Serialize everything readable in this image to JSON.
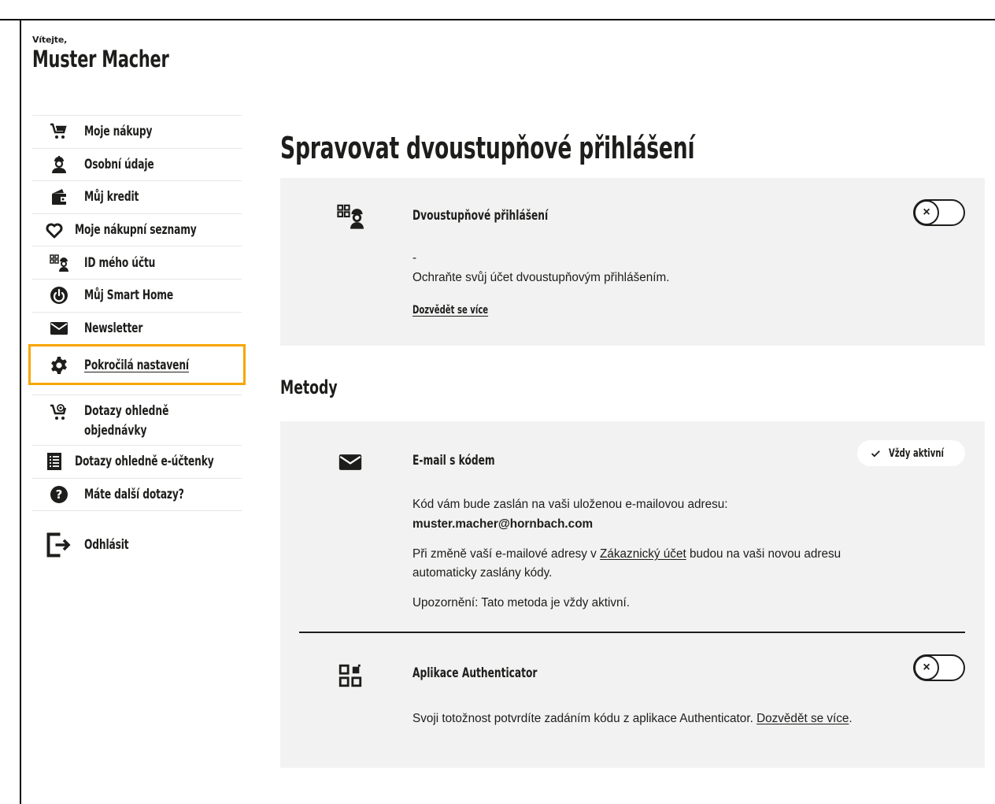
{
  "greeting": {
    "welcome": "Vítejte,",
    "name": "Muster Macher"
  },
  "sidebar": {
    "items": [
      {
        "label": "Moje nákupy",
        "icon": "cart-icon"
      },
      {
        "label": "Osobní údaje",
        "icon": "worker-icon"
      },
      {
        "label": "Můj kredit",
        "icon": "wallet-icon"
      },
      {
        "label": "Moje nákupní seznamy",
        "icon": "heart-icon"
      },
      {
        "label": "ID mého účtu",
        "icon": "account-id-icon"
      },
      {
        "label": "Můj Smart Home",
        "icon": "power-icon"
      },
      {
        "label": "Newsletter",
        "icon": "mail-icon"
      },
      {
        "label": "Pokročilá nastavení",
        "icon": "gear-icon",
        "active": true
      },
      {
        "label": "Dotazy ohledně",
        "label2": "objednávky",
        "icon": "cart-at-icon"
      },
      {
        "label": "Dotazy ohledně e-účtenky",
        "icon": "receipt-icon"
      },
      {
        "label": "Máte další dotazy?",
        "icon": "question-icon"
      }
    ],
    "logout": {
      "label": "Odhlásit",
      "icon": "logout-icon"
    }
  },
  "main": {
    "title": "Spravovat dvoustupňové přihlášení",
    "two_factor": {
      "title": "Dvoustupňové přihlášení",
      "dash": "-",
      "description": "Ochraňte svůj účet dvoustupňovým přihlášením.",
      "learn_more": "Dozvědět se více",
      "toggle_symbol": "×"
    },
    "methods_title": "Metody",
    "email_method": {
      "title": "E-mail s kódem",
      "badge": "Vždy aktivní",
      "line1": "Kód vám bude zaslán na vaši uloženou e-mailovou adresu:",
      "email": "muster.macher@hornbach.com",
      "line2_before": "Při změně vaší e-mailové adresy v ",
      "line2_link": "Zákaznický účet",
      "line2_after": " budou na vaši novou adresu automaticky zaslány kódy.",
      "note": "Upozornění: Tato metoda je vždy aktivní."
    },
    "authenticator": {
      "title": "Aplikace Authenticator",
      "text_before": "Svoji totožnost potvrdíte zadáním kódu z aplikace Authenticator. ",
      "link": "Dozvědět se více",
      "text_after": ".",
      "toggle_symbol": "×"
    }
  }
}
